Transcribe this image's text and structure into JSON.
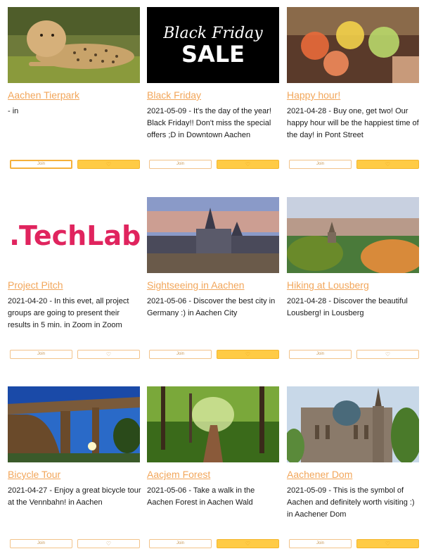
{
  "events": [
    {
      "title": "Aachen Tierpark",
      "description": "- in",
      "join_label": "Join",
      "fav_icon": "heart-icon",
      "fav_active": true,
      "join_focused": true,
      "image": "cheetah-photo"
    },
    {
      "title": "Black Friday",
      "description": "2021-05-09 - It's the day of the year! Black Friday!! Don't miss the special offers ;D in Downtown Aachen",
      "join_label": "Join",
      "fav_icon": "heart-icon",
      "fav_active": true,
      "join_focused": false,
      "image": "black-friday-banner",
      "image_text_script": "Black Friday",
      "image_text_bold": "SALE"
    },
    {
      "title": "Happy hour!",
      "description": "2021-04-28 - Buy one, get two! Our happy hour will be the happiest time of the day! in Pont Street",
      "join_label": "Join",
      "fav_icon": "heart-icon",
      "fav_active": true,
      "join_focused": false,
      "image": "cocktails-photo"
    },
    {
      "title": "Project Pitch",
      "description": "2021-04-20 - In this evet, all project groups are going to present their results in 5 min. in Zoom in Zoom",
      "join_label": "Join",
      "fav_icon": "heart-icon",
      "fav_active": false,
      "join_focused": false,
      "image": "techlab-logo",
      "image_text_a": "TechLab",
      "image_text_prefix": "."
    },
    {
      "title": "Sightseeing in Aachen",
      "description": "2021-05-06 - Discover the best city in Germany :) in Aachen City",
      "join_label": "Join",
      "fav_icon": "heart-icon",
      "fav_active": true,
      "join_focused": false,
      "image": "aachen-city-photo"
    },
    {
      "title": "Hiking at Lousberg",
      "description": "2021-04-28 - Discover the beautiful Lousberg! in Lousberg",
      "join_label": "Join",
      "fav_icon": "heart-icon",
      "fav_active": false,
      "join_focused": false,
      "image": "lousberg-photo"
    },
    {
      "title": "Bicycle Tour",
      "description": "2021-04-27 - Enjoy a great bicycle tour at the Vennbahn! in Aachen",
      "join_label": "Join",
      "fav_icon": "heart-icon",
      "fav_active": false,
      "join_focused": false,
      "image": "viaduct-photo"
    },
    {
      "title": "Aacjem Forest",
      "description": "2021-05-06 - Take a walk in the Aachen Forest in Aachen Wald",
      "join_label": "Join",
      "fav_icon": "heart-icon",
      "fav_active": true,
      "join_focused": false,
      "image": "forest-photo"
    },
    {
      "title": "Aachener Dom",
      "description": "2021-05-09 - This is the symbol of Aachen and definitely worth visiting :) in Aachener Dom",
      "join_label": "Join",
      "fav_icon": "heart-icon",
      "fav_active": true,
      "join_focused": false,
      "image": "cathedral-photo"
    }
  ],
  "colors": {
    "accent": "#f2a65a",
    "fav_active": "#ffcb45",
    "border": "#f2c38a"
  }
}
